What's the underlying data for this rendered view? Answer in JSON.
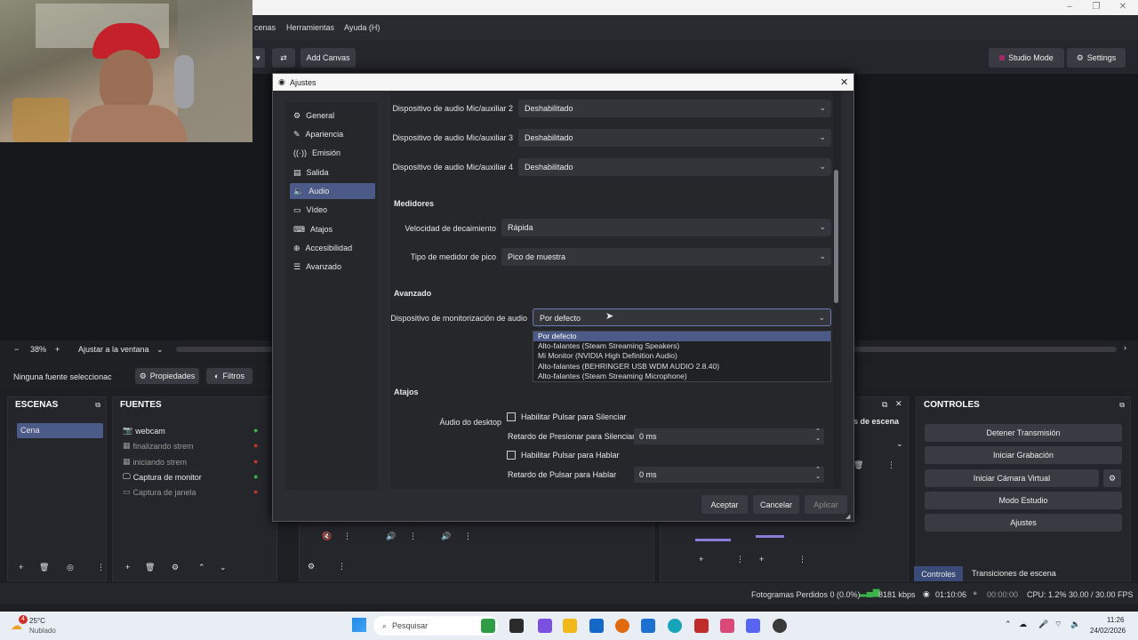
{
  "menu": {
    "items": [
      "cenas",
      "Herramientas",
      "Ayuda (H)"
    ]
  },
  "toolbar": {
    "add_canvas": "Add Canvas",
    "studio_mode": "Studio Mode",
    "settings": "Settings"
  },
  "zoom": {
    "minus": "−",
    "value": "38%",
    "plus": "+",
    "fit": "Ajustar a la ventana"
  },
  "props_bar": {
    "no_source": "Ninguna fuente seleccionac",
    "properties": "Propiedades",
    "filters": "Filtros"
  },
  "scenes": {
    "title": "ESCENAS",
    "items": [
      "Cena"
    ]
  },
  "sources": {
    "title": "FUENTES",
    "items": [
      "webcam",
      "finalizando strem",
      "iniciando strem",
      "Captura de monitor",
      "Captura de janela"
    ]
  },
  "controls": {
    "title": "CONTROLES",
    "buttons": [
      "Detener Transmisión",
      "Iniciar Grabación",
      "Iniciar Cámara Virtual",
      "Modo Estudio",
      "Ajustes"
    ],
    "tabs": [
      "Controles",
      "Transiciones de escena"
    ]
  },
  "transitions_partial": "s de escena",
  "status": {
    "frames": "Fotogramas Perdidos 0 (0.0%)",
    "kbps": "8181 kbps",
    "stream_time": "01:10:06",
    "rec_time": "00:00:00",
    "cpu": "CPU: 1.2%",
    "fps": "30.00 / 30.00 FPS"
  },
  "taskbar": {
    "weather_temp": "25°C",
    "weather_desc": "Nublado",
    "weather_badge": "4",
    "search": "Pesquisar",
    "time": "11:26",
    "date": "24/02/2026"
  },
  "dialog": {
    "title": "Ajustes",
    "sidebar": [
      "General",
      "Apariencia",
      "Emisión",
      "Salida",
      "Audio",
      "Vídeo",
      "Atajos",
      "Accesibilidad",
      "Avanzado"
    ],
    "active_index": 4,
    "mic_rows": [
      {
        "label": "Dispositivo de audio Mic/auxiliar 2",
        "value": "Deshabilitado"
      },
      {
        "label": "Dispositivo de audio Mic/auxiliar 3",
        "value": "Deshabilitado"
      },
      {
        "label": "Dispositivo de audio Mic/auxiliar 4",
        "value": "Deshabilitado"
      }
    ],
    "meters": {
      "title": "Medidores",
      "decay_label": "Velocidad de decaimiento",
      "decay_value": "Rápida",
      "peak_label": "Tipo de medidor de pico",
      "peak_value": "Pico de muestra"
    },
    "advanced": {
      "title": "Avanzado",
      "monitor_label": "Dispositivo de monitorización de audio",
      "monitor_value": "Por defecto",
      "options": [
        "Por defecto",
        "Alto-falantes (Steam Streaming Speakers)",
        "Mi Monitor (NVIDIA High Definition Audio)",
        "Alto-falantes (BEHRINGER USB WDM AUDIO 2.8.40)",
        "Alto-falantes (Steam Streaming Microphone)"
      ]
    },
    "hotkeys": {
      "title": "Atajos",
      "desktop_label": "Áudio do desktop",
      "mute_check": "Habilitar Pulsar para Silenciar",
      "mute_delay_label": "Retardo de Presionar para Silenciar",
      "mute_delay": "0 ms",
      "talk_check": "Habilitar Pulsar para Hablar",
      "talk_delay_label": "Retardo de Pulsar para Hablar",
      "talk_delay": "0 ms"
    },
    "buttons": {
      "ok": "Aceptar",
      "cancel": "Cancelar",
      "apply": "Aplicar"
    }
  },
  "colors": {
    "accent": "#4c5a87",
    "eye_on": "#3cb44a",
    "eye_off": "#c0392b"
  }
}
